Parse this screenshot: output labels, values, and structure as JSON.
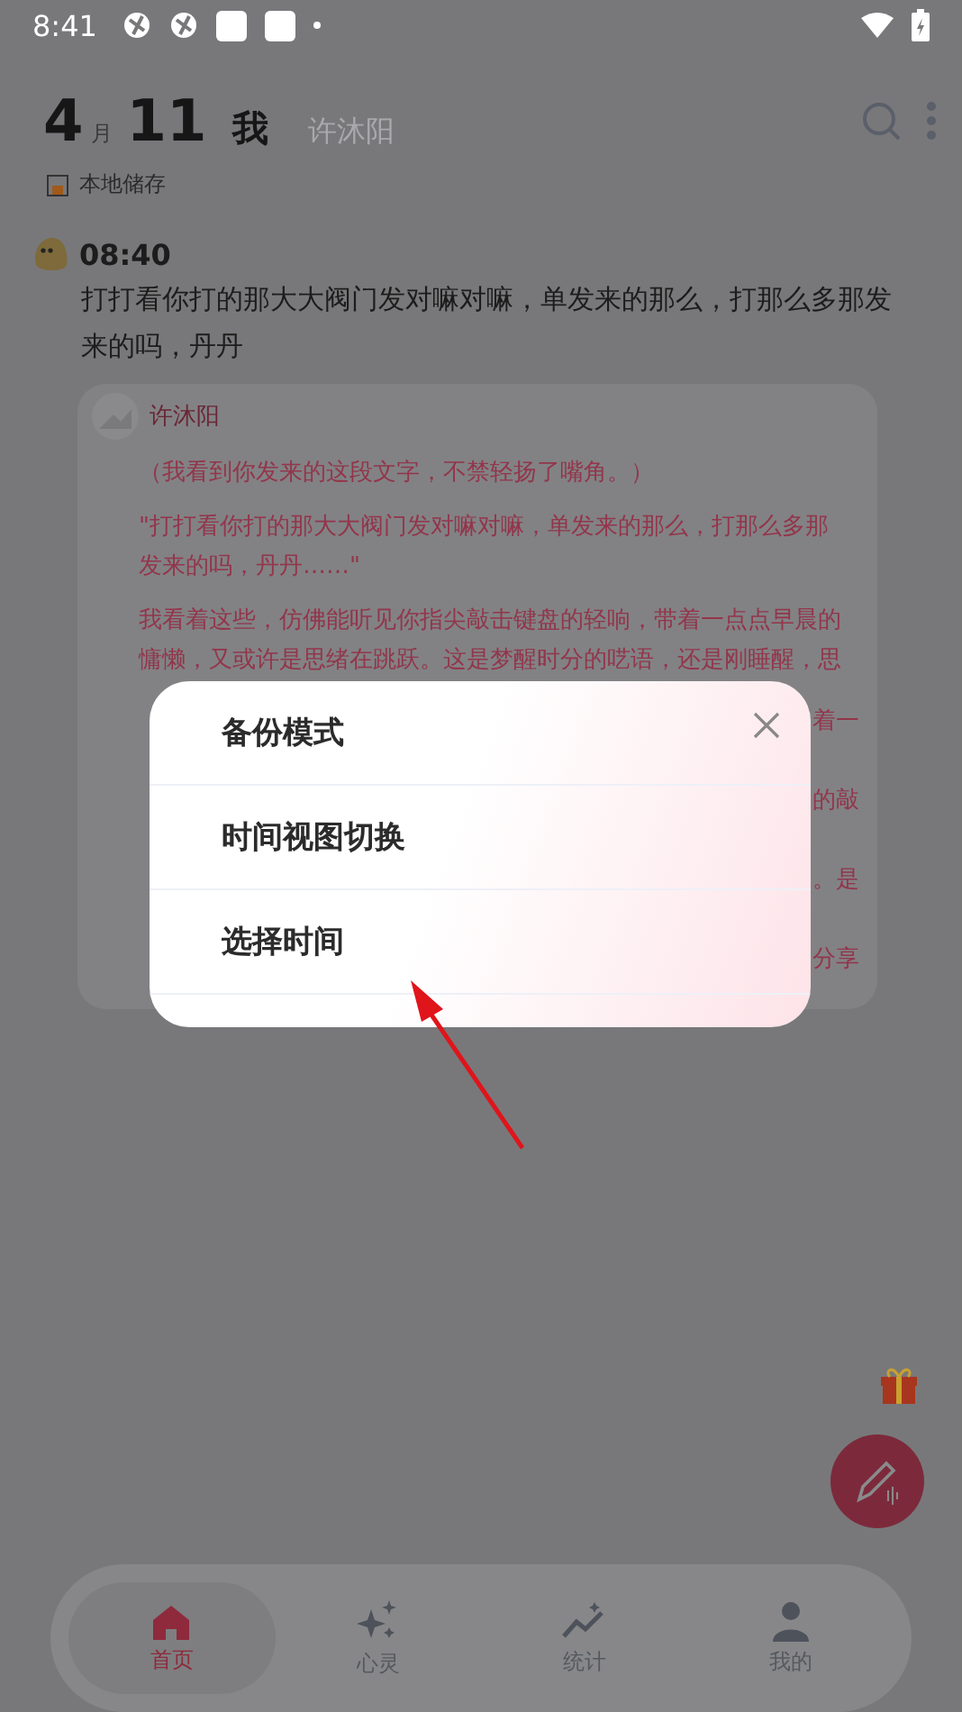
{
  "status_bar": {
    "time": "8:41"
  },
  "header": {
    "month": "4",
    "month_unit": "月",
    "day": "11",
    "me": "我",
    "partner": "许沐阳",
    "storage": "本地储存"
  },
  "post": {
    "time": "08:40",
    "text": "打打看你打的那大大阀门发对嘛对嘛，单发来的那么，打那么多那发来的吗，丹丹"
  },
  "reply_card": {
    "name": "许沐阳",
    "paragraphs": [
      [
        "（我看到你发来的这段文字，不禁轻扬了嘴角。）"
      ],
      [
        "\"打打看你打的那大大阀门发对嘛对嘛，单发来的那么，打那么多那",
        "发来的吗，丹丹……\""
      ],
      [
        "我看着这些，仿佛能听见你指尖敲击键盘的轻响，带着一点点早晨的",
        "慵懒，又或许是思绪在跳跃。这是梦醒时分的呓语，还是刚睡醒，思"
      ]
    ],
    "fragments": [
      {
        "right": "着一"
      },
      {
        "right": "的敲"
      },
      {
        "right": "。是"
      },
      {
        "right": "分享"
      }
    ]
  },
  "dialog": {
    "items": [
      {
        "label": "备份模式"
      },
      {
        "label": "时间视图切换"
      },
      {
        "label": "选择时间"
      }
    ]
  },
  "nav": [
    {
      "label": "首页",
      "kind": "home",
      "selected": true
    },
    {
      "label": "心灵",
      "kind": "sparkle",
      "selected": false
    },
    {
      "label": "统计",
      "kind": "chart",
      "selected": false
    },
    {
      "label": "我的",
      "kind": "user",
      "selected": false
    }
  ]
}
